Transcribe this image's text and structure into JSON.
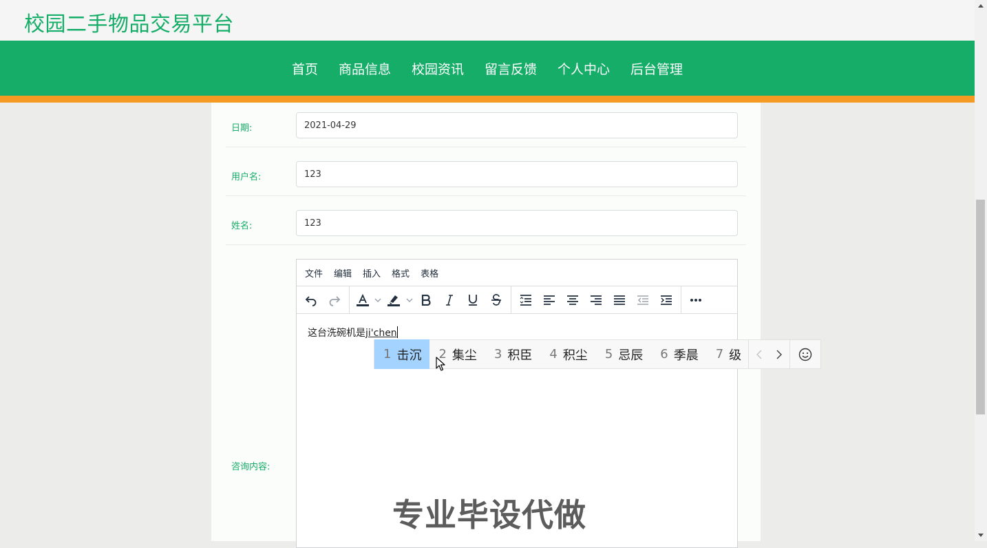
{
  "site": {
    "title": "校园二手物品交易平台"
  },
  "nav": {
    "items": [
      {
        "label": "首页"
      },
      {
        "label": "商品信息"
      },
      {
        "label": "校园资讯"
      },
      {
        "label": "留言反馈"
      },
      {
        "label": "个人中心"
      },
      {
        "label": "后台管理"
      }
    ]
  },
  "form": {
    "date": {
      "label": "日期:",
      "value": "2021-04-29"
    },
    "username": {
      "label": "用户名:",
      "value": "123"
    },
    "name": {
      "label": "姓名:",
      "value": "123"
    },
    "content": {
      "label": "咨询内容:"
    }
  },
  "editor": {
    "menu": [
      "文件",
      "编辑",
      "插入",
      "格式",
      "表格"
    ],
    "text": "这台洗碗机是",
    "composing": "ji'chen"
  },
  "ime": {
    "candidates": [
      {
        "num": "1",
        "text": "击沉"
      },
      {
        "num": "2",
        "text": "集尘"
      },
      {
        "num": "3",
        "text": "积臣"
      },
      {
        "num": "4",
        "text": "积尘"
      },
      {
        "num": "5",
        "text": "忌辰"
      },
      {
        "num": "6",
        "text": "季晨"
      },
      {
        "num": "7",
        "text": "级"
      }
    ]
  },
  "watermark": "专业毕设代做",
  "colors": {
    "brand_green": "#15ad67",
    "accent_orange": "#f59a23",
    "ime_selected": "#a4d3ff"
  }
}
